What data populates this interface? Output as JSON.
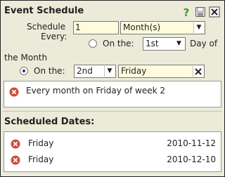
{
  "panel": {
    "title": "Event Schedule",
    "icons": [
      "help-icon",
      "save-icon",
      "close-icon"
    ]
  },
  "form": {
    "schedule_every_label_1": "Schedule",
    "schedule_every_label_2": "Every:",
    "interval_value": "1",
    "period_select": "Month(s)",
    "option_day": {
      "label": "On the:",
      "day_select": "1st",
      "suffix": "Day of",
      "suffix_2": "the Month",
      "checked": false
    },
    "option_weekday": {
      "label": "On the:",
      "week_select": "2nd",
      "weekday_select": "Friday",
      "checked": true
    }
  },
  "summary": {
    "text": "Every month on Friday of week 2"
  },
  "scheduled": {
    "heading": "Scheduled Dates:",
    "items": [
      {
        "name": "Friday",
        "date": "2010-11-12"
      },
      {
        "name": "Friday",
        "date": "2010-12-10"
      }
    ]
  },
  "colors": {
    "panel_bg": "#ecead9",
    "input_bg": "#fffbdc",
    "help_icon": "#3a9a2a",
    "delete_icon": "#d24a3c"
  }
}
